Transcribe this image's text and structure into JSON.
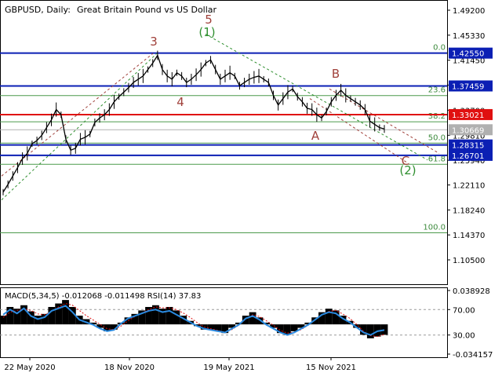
{
  "header": {
    "symbol_timeframe": "GBPUSD, Daily:",
    "description": "Great Britain Pound vs US Dollar"
  },
  "colors": {
    "background": "#ffffff",
    "candle": "#000000",
    "fib_line": "#4c9a4c",
    "fib_text": "#3c8a3c",
    "blue_level": "#0b1fb4",
    "red_level": "#e01010",
    "wave_red": "#a0403a",
    "wave_green": "#2f8f2f",
    "macd_hist": "#000000",
    "macd_signal": "#e01010",
    "rsi": "#2a8ae0",
    "grid_dash": "#9a9a9a"
  },
  "chart_data": [
    {
      "type": "line",
      "title": "GBPUSD, Daily: Great Britain Pound vs US Dollar",
      "price_scale": {
        "min": 1.08,
        "max": 1.5,
        "ticks": [
          "1.49200",
          "1.45330",
          "1.41450",
          "1.37600",
          "1.33700",
          "1.29810",
          "1.25940",
          "1.22110",
          "1.18240",
          "1.14370",
          "1.10500"
        ]
      },
      "time_axis": [
        "22 May 2020",
        "18 Nov 2020",
        "19 May 2021",
        "15 Nov 2021"
      ],
      "series": [
        {
          "values": [
            1.21,
            1.222,
            1.235,
            1.248,
            1.262,
            1.27,
            1.285,
            1.29,
            1.298,
            1.31,
            1.322,
            1.338,
            1.33,
            1.292,
            1.275,
            1.278,
            1.292,
            1.295,
            1.3,
            1.318,
            1.325,
            1.33,
            1.338,
            1.35,
            1.358,
            1.365,
            1.372,
            1.38,
            1.385,
            1.39,
            1.4,
            1.41,
            1.422,
            1.4,
            1.39,
            1.385,
            1.395,
            1.39,
            1.38,
            1.385,
            1.392,
            1.4,
            1.41,
            1.415,
            1.4,
            1.385,
            1.39,
            1.395,
            1.39,
            1.375,
            1.38,
            1.385,
            1.388,
            1.39,
            1.385,
            1.38,
            1.36,
            1.345,
            1.355,
            1.365,
            1.37,
            1.358,
            1.35,
            1.34,
            1.338,
            1.33,
            1.325,
            1.335,
            1.35,
            1.36,
            1.368,
            1.36,
            1.355,
            1.35,
            1.345,
            1.338,
            1.32,
            1.315,
            1.31,
            1.308
          ]
        }
      ],
      "horizontal_levels": [
        {
          "label": "1.42550",
          "price": 1.4255,
          "kind": "blue"
        },
        {
          "label": "1.37459",
          "price": 1.37459,
          "kind": "blue"
        },
        {
          "label": "1.33021",
          "price": 1.33021,
          "kind": "red"
        },
        {
          "label": "1.30669",
          "price": 1.30669,
          "kind": "gray"
        },
        {
          "label": "1.28315",
          "price": 1.28315,
          "kind": "blue"
        },
        {
          "label": "1.26701",
          "price": 1.26701,
          "kind": "blue"
        }
      ],
      "fibonacci_levels": [
        {
          "label": "0.0",
          "price": 1.4255
        },
        {
          "label": "23.6",
          "price": 1.3597
        },
        {
          "label": "38.2",
          "price": 1.319
        },
        {
          "label": "50.0",
          "price": 1.286
        },
        {
          "label": "61.8",
          "price": 1.2531
        },
        {
          "label": "100.0",
          "price": 1.147
        }
      ],
      "wave_labels": [
        {
          "text": "3",
          "style": "red"
        },
        {
          "text": "5",
          "style": "red"
        },
        {
          "text": "(1)",
          "style": "green"
        },
        {
          "text": "4",
          "style": "red"
        },
        {
          "text": "B",
          "style": "red"
        },
        {
          "text": "A",
          "style": "red"
        },
        {
          "text": "C",
          "style": "red"
        },
        {
          "text": "(2)",
          "style": "green"
        }
      ]
    },
    {
      "type": "bar",
      "title": "MACD(5,34,5) -0.012068 -0.011498 RSI(14) 37.83",
      "ylim": [
        -0.034157,
        0.038928
      ],
      "ticks": [
        "0.038928",
        "70.00",
        "30.00",
        "-0.034157"
      ],
      "series": [
        {
          "values": [
            0.01,
            0.02,
            0.018,
            0.022,
            0.015,
            0.01,
            0.012,
            0.02,
            0.024,
            0.028,
            0.02,
            0.01,
            0.006,
            0.002,
            -0.004,
            -0.008,
            -0.006,
            0.002,
            0.008,
            0.012,
            0.016,
            0.02,
            0.022,
            0.018,
            0.02,
            0.016,
            0.01,
            0.004,
            -0.002,
            -0.006,
            -0.006,
            -0.008,
            -0.01,
            -0.004,
            0.002,
            0.01,
            0.014,
            0.008,
            0.002,
            -0.004,
            -0.01,
            -0.012,
            -0.008,
            -0.004,
            0.002,
            0.008,
            0.014,
            0.018,
            0.016,
            0.01,
            0.004,
            -0.004,
            -0.012,
            -0.016,
            -0.014,
            -0.012
          ]
        },
        {
          "values": [
            0.008,
            0.014,
            0.016,
            0.018,
            0.016,
            0.012,
            0.011,
            0.015,
            0.02,
            0.024,
            0.022,
            0.016,
            0.01,
            0.005,
            0,
            -0.005,
            -0.006,
            -0.002,
            0.004,
            0.009,
            0.013,
            0.017,
            0.02,
            0.019,
            0.019,
            0.017,
            0.013,
            0.008,
            0.002,
            -0.003,
            -0.005,
            -0.007,
            -0.009,
            -0.006,
            -0.001,
            0.006,
            0.011,
            0.009,
            0.004,
            -0.001,
            -0.007,
            -0.01,
            -0.009,
            -0.006,
            -0.001,
            0.005,
            0.011,
            0.015,
            0.016,
            0.012,
            0.007,
            0,
            -0.008,
            -0.013,
            -0.014,
            -0.0115
          ]
        },
        {
          "values": [
            62,
            70,
            64,
            72,
            60,
            55,
            58,
            68,
            72,
            76,
            66,
            54,
            50,
            46,
            40,
            36,
            38,
            48,
            56,
            60,
            64,
            68,
            70,
            66,
            68,
            62,
            56,
            50,
            44,
            40,
            38,
            36,
            34,
            40,
            46,
            56,
            60,
            54,
            46,
            40,
            34,
            30,
            34,
            40,
            46,
            54,
            62,
            66,
            64,
            56,
            50,
            42,
            34,
            30,
            36,
            37.83
          ]
        }
      ]
    }
  ]
}
